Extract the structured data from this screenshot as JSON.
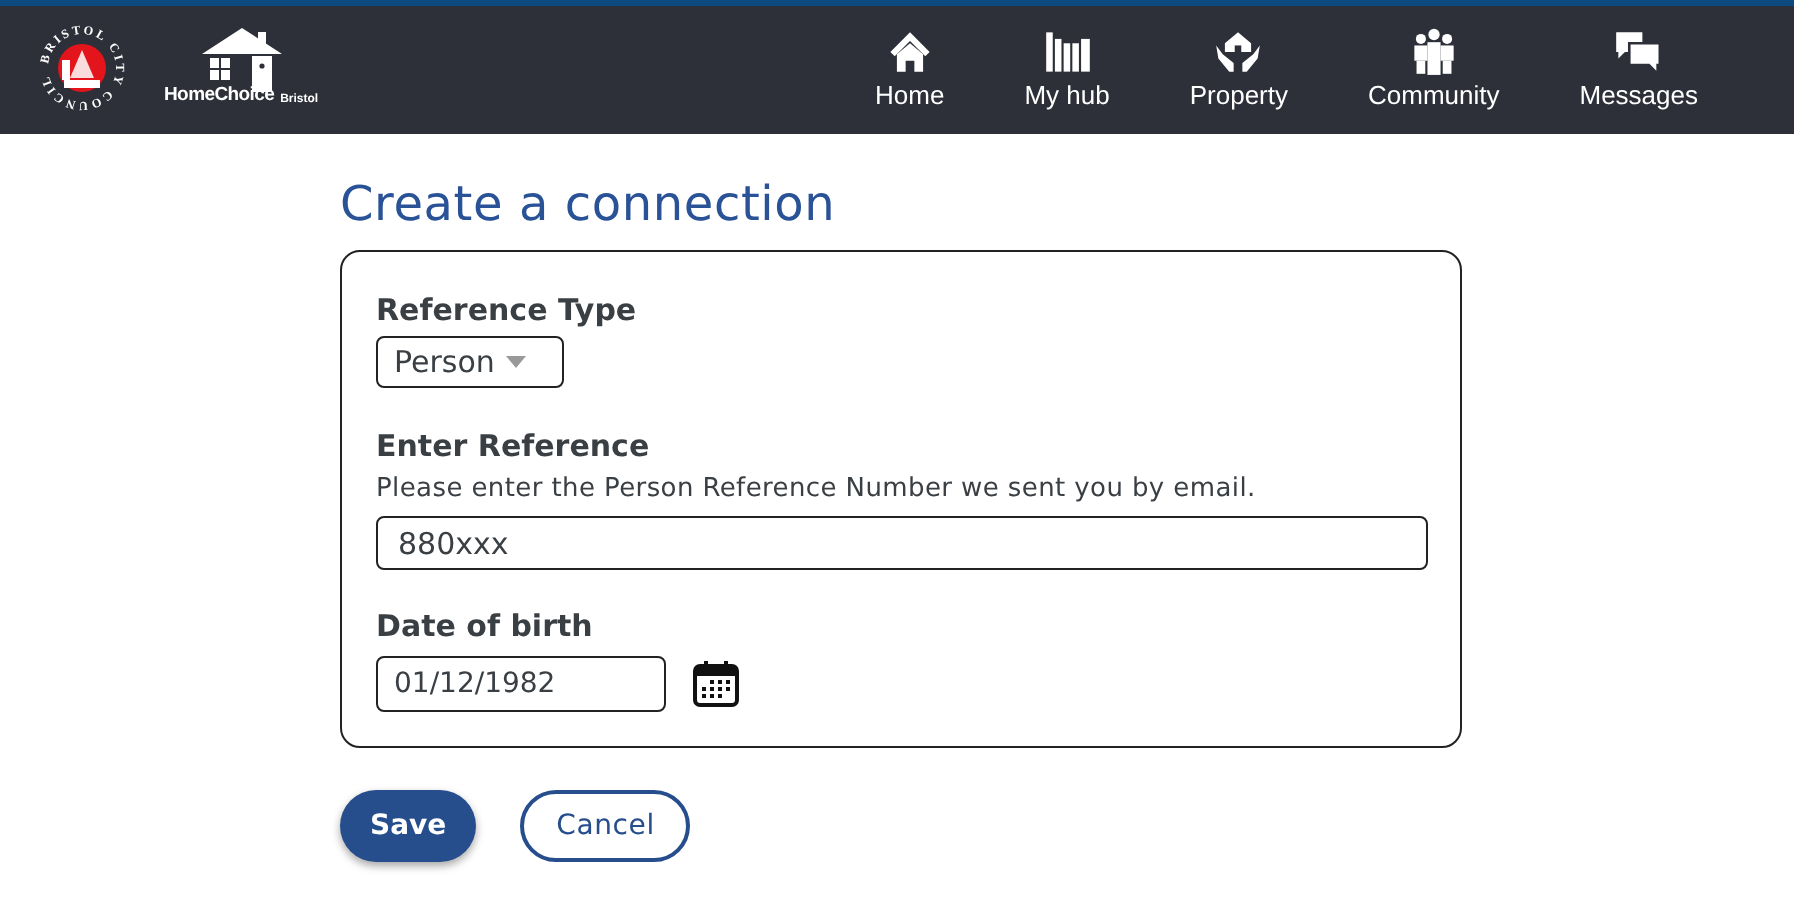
{
  "header": {
    "council_logo_text": "BRISTOL CITY COUNCIL",
    "brand": "HomeChoice",
    "brand_suffix": "Bristol",
    "nav": [
      {
        "label": "Home",
        "kind": "home"
      },
      {
        "label": "My hub",
        "kind": "hub"
      },
      {
        "label": "Property",
        "kind": "property"
      },
      {
        "label": "Community",
        "kind": "community"
      },
      {
        "label": "Messages",
        "kind": "messages"
      }
    ]
  },
  "title": "Create a connection",
  "form": {
    "reference_type": {
      "label": "Reference Type",
      "value": "Person"
    },
    "reference": {
      "label": "Enter Reference",
      "hint": "Please enter the Person Reference Number we sent you by email.",
      "value": "880xxx"
    },
    "date_of_birth": {
      "label": "Date of birth",
      "value": "01/12/1982"
    }
  },
  "buttons": [
    {
      "label": "Save",
      "kind": "primary"
    },
    {
      "label": "Cancel",
      "kind": "secondary"
    }
  ]
}
